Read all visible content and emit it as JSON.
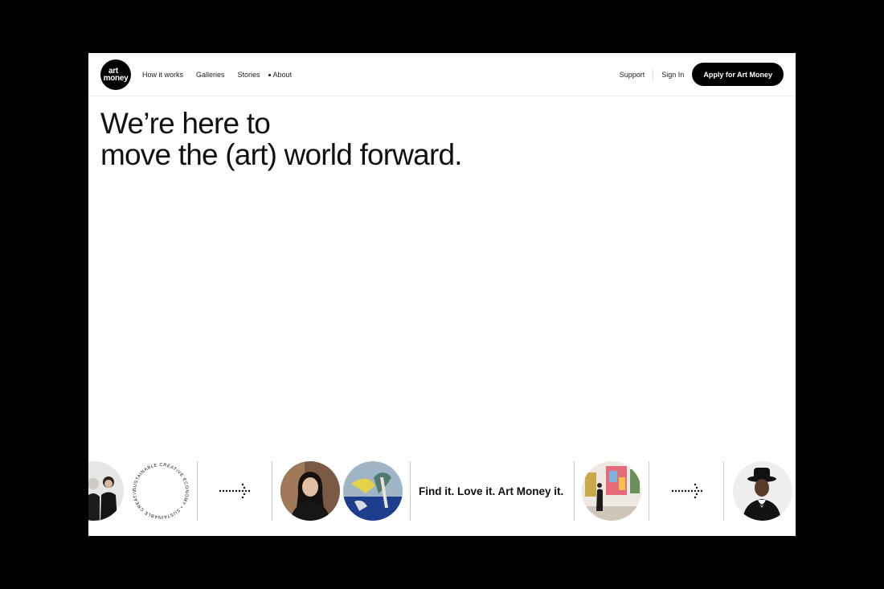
{
  "logo": {
    "line1": "art",
    "line2": "money"
  },
  "nav": {
    "left": [
      {
        "label": "How it works"
      },
      {
        "label": "Galleries"
      },
      {
        "label": "Stories"
      },
      {
        "label": "About",
        "active": true
      }
    ],
    "support": "Support",
    "sign_in": "Sign In",
    "apply": "Apply for Art Money"
  },
  "hero": {
    "line1": "We’re here to",
    "line2": "move the (art) world forward."
  },
  "strip": {
    "badge_text": "SUSTAINABLE CREATIVE ECONOMY • SUSTAINABLE CREATIVE ECONOMY •",
    "tagline": "Find it. Love it. Art Money it."
  },
  "colors": {
    "background": "#ffffff",
    "accent": "#000000",
    "frame": "#000000"
  }
}
